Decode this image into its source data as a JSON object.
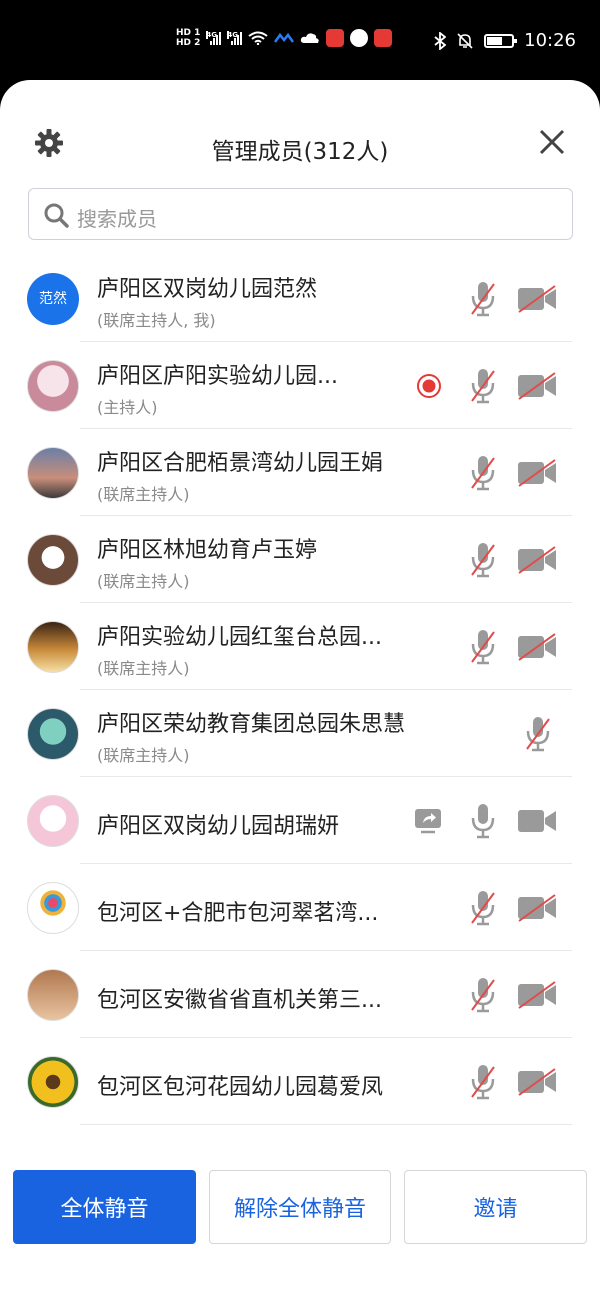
{
  "status_bar": {
    "hd_top": "HD 1",
    "hd_bottom": "HD 2",
    "network1": "4G",
    "network2": "4G",
    "time": "10:26",
    "battery_level": 0.6
  },
  "header": {
    "title": "管理成员(312人)"
  },
  "search": {
    "placeholder": "搜索成员"
  },
  "members": [
    {
      "name": "庐阳区双岗幼儿园范然",
      "role": "(联席主持人, 我)",
      "avatar_text": "范然",
      "recording": false,
      "sharing": false,
      "mic_muted": true,
      "camera": "off"
    },
    {
      "name": "庐阳区庐阳实验幼儿园...",
      "role": "(主持人)",
      "avatar_text": "",
      "recording": true,
      "sharing": false,
      "mic_muted": true,
      "camera": "off"
    },
    {
      "name": "庐阳区合肥栢景湾幼儿园王娟",
      "role": "(联席主持人)",
      "avatar_text": "",
      "recording": false,
      "sharing": false,
      "mic_muted": true,
      "camera": "off"
    },
    {
      "name": "庐阳区林旭幼育卢玉婷",
      "role": "(联席主持人)",
      "avatar_text": "",
      "recording": false,
      "sharing": false,
      "mic_muted": true,
      "camera": "off"
    },
    {
      "name": "庐阳实验幼儿园红玺台总园...",
      "role": "(联席主持人)",
      "avatar_text": "",
      "recording": false,
      "sharing": false,
      "mic_muted": true,
      "camera": "off"
    },
    {
      "name": "庐阳区荣幼教育集团总园朱思慧",
      "role": "(联席主持人)",
      "avatar_text": "",
      "recording": false,
      "sharing": false,
      "mic_muted": true,
      "camera": "none"
    },
    {
      "name": "庐阳区双岗幼儿园胡瑞妍",
      "role": "",
      "avatar_text": "",
      "recording": false,
      "sharing": true,
      "mic_muted": false,
      "camera": "on"
    },
    {
      "name": "包河区+合肥市包河翠茗湾...",
      "role": "",
      "avatar_text": "",
      "recording": false,
      "sharing": false,
      "mic_muted": true,
      "camera": "off"
    },
    {
      "name": "包河区安徽省省直机关第三...",
      "role": "",
      "avatar_text": "",
      "recording": false,
      "sharing": false,
      "mic_muted": true,
      "camera": "off"
    },
    {
      "name": "包河区包河花园幼儿园葛爱凤",
      "role": "",
      "avatar_text": "",
      "recording": false,
      "sharing": false,
      "mic_muted": true,
      "camera": "off"
    }
  ],
  "footer": {
    "mute_all": "全体静音",
    "unmute_all": "解除全体静音",
    "invite": "邀请"
  },
  "colors": {
    "accent": "#1a63e0",
    "muted_slash": "#e04b4b",
    "icon_gray": "#9a9a9a",
    "record_red": "#e53935"
  }
}
